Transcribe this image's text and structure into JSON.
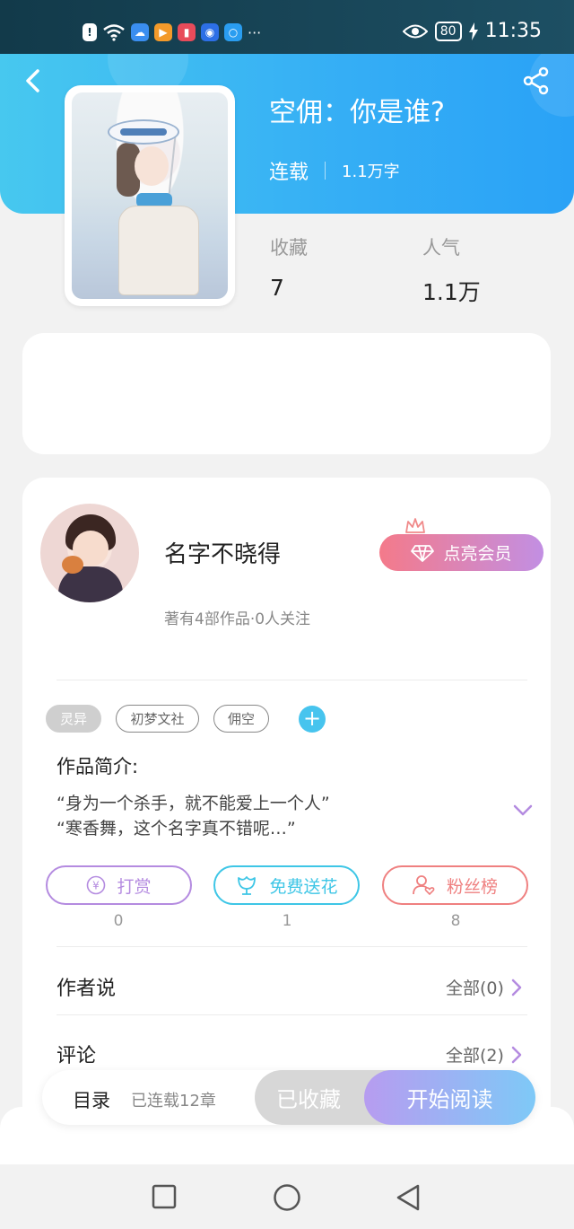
{
  "status_bar": {
    "time": "11:35",
    "battery": "80",
    "more_indicator": "···",
    "icons": [
      "alert-icon",
      "wifi-icon",
      "cloud-app-icon",
      "video-app-icon",
      "book-app-icon",
      "idea-app-icon",
      "search-app-icon",
      "eye-comfort-icon",
      "charging-icon"
    ]
  },
  "header": {
    "title": "空佣：你是谁?",
    "serial_status": "连载",
    "word_count": "1.1万字"
  },
  "stats": [
    {
      "label": "收藏",
      "value": "7"
    },
    {
      "label": "人气",
      "value": "1.1万"
    }
  ],
  "author": {
    "name": "名字不晓得",
    "meta": "著有4部作品·0人关注",
    "vip_button": "点亮会员"
  },
  "tags": [
    "灵异",
    "初梦文社",
    "佣空"
  ],
  "intro": {
    "label": "作品简介:",
    "lines": [
      "“身为一个杀手，就不能爱上一个人”",
      "“寒香舞，这个名字真不错呢…”"
    ]
  },
  "actions": [
    {
      "label": "打赏",
      "count": "0",
      "color": "#b48be0"
    },
    {
      "label": "免费送花",
      "count": "1",
      "color": "#3ec6e6"
    },
    {
      "label": "粉丝榜",
      "count": "8",
      "color": "#ef8080"
    }
  ],
  "rows": [
    {
      "title": "作者说",
      "more": "全部(0)"
    },
    {
      "title": "评论",
      "more": "全部(2)"
    }
  ],
  "bottom_bar": {
    "toc": "目录",
    "toc_info": "已连载12章",
    "favorited": "已收藏",
    "start_reading": "开始阅读"
  },
  "colors": {
    "header_accent": "#35aef5",
    "vip_gradient_start": "#f47a8a",
    "vip_gradient_end": "#c28fe3",
    "tag_add": "#47c4ee"
  }
}
